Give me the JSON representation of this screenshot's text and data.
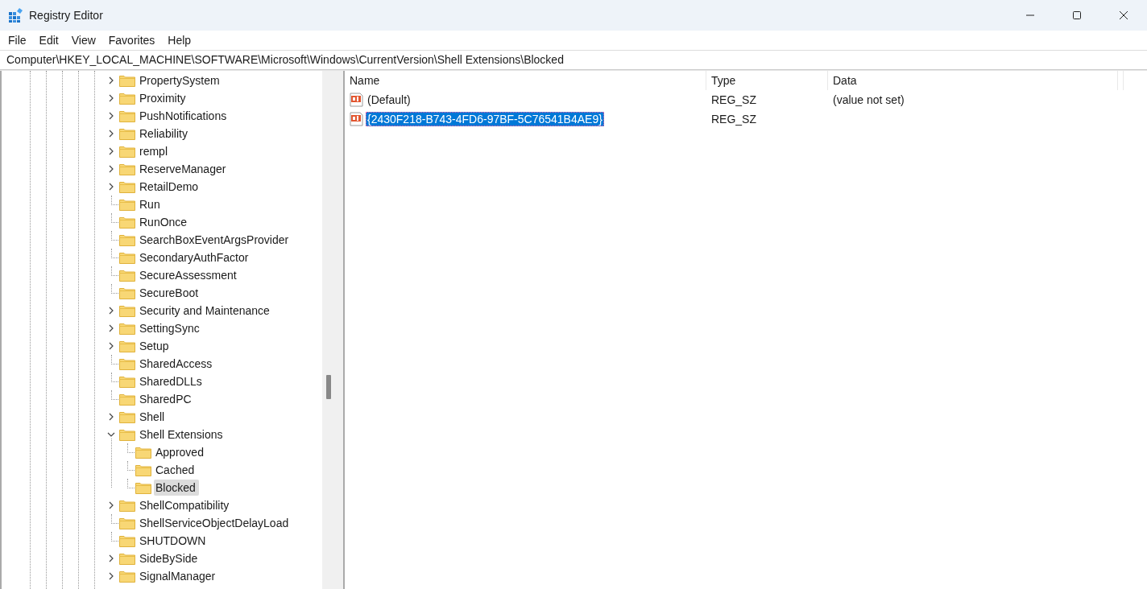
{
  "window": {
    "title": "Registry Editor"
  },
  "menu": [
    "File",
    "Edit",
    "View",
    "Favorites",
    "Help"
  ],
  "address": "Computer\\HKEY_LOCAL_MACHINE\\SOFTWARE\\Microsoft\\Windows\\CurrentVersion\\Shell Extensions\\Blocked",
  "tree": [
    {
      "name": "PropertySystem",
      "expandable": true,
      "expanded": false,
      "selected": false
    },
    {
      "name": "Proximity",
      "expandable": true,
      "expanded": false,
      "selected": false
    },
    {
      "name": "PushNotifications",
      "expandable": true,
      "expanded": false,
      "selected": false
    },
    {
      "name": "Reliability",
      "expandable": true,
      "expanded": false,
      "selected": false
    },
    {
      "name": "rempl",
      "expandable": true,
      "expanded": false,
      "selected": false
    },
    {
      "name": "ReserveManager",
      "expandable": true,
      "expanded": false,
      "selected": false
    },
    {
      "name": "RetailDemo",
      "expandable": true,
      "expanded": false,
      "selected": false
    },
    {
      "name": "Run",
      "expandable": false,
      "selected": false
    },
    {
      "name": "RunOnce",
      "expandable": false,
      "selected": false
    },
    {
      "name": "SearchBoxEventArgsProvider",
      "expandable": false,
      "selected": false
    },
    {
      "name": "SecondaryAuthFactor",
      "expandable": false,
      "selected": false
    },
    {
      "name": "SecureAssessment",
      "expandable": false,
      "selected": false
    },
    {
      "name": "SecureBoot",
      "expandable": false,
      "selected": false
    },
    {
      "name": "Security and Maintenance",
      "expandable": true,
      "expanded": false,
      "selected": false
    },
    {
      "name": "SettingSync",
      "expandable": true,
      "expanded": false,
      "selected": false
    },
    {
      "name": "Setup",
      "expandable": true,
      "expanded": false,
      "selected": false
    },
    {
      "name": "SharedAccess",
      "expandable": false,
      "selected": false
    },
    {
      "name": "SharedDLLs",
      "expandable": false,
      "selected": false
    },
    {
      "name": "SharedPC",
      "expandable": false,
      "selected": false
    },
    {
      "name": "Shell",
      "expandable": true,
      "expanded": false,
      "selected": false
    },
    {
      "name": "Shell Extensions",
      "expandable": true,
      "expanded": true,
      "selected": false,
      "children": [
        {
          "name": "Approved",
          "expandable": false,
          "selected": false
        },
        {
          "name": "Cached",
          "expandable": false,
          "selected": false
        },
        {
          "name": "Blocked",
          "expandable": false,
          "selected": true
        }
      ]
    },
    {
      "name": "ShellCompatibility",
      "expandable": true,
      "expanded": false,
      "selected": false
    },
    {
      "name": "ShellServiceObjectDelayLoad",
      "expandable": false,
      "selected": false
    },
    {
      "name": "SHUTDOWN",
      "expandable": false,
      "selected": false
    },
    {
      "name": "SideBySide",
      "expandable": true,
      "expanded": false,
      "selected": false
    },
    {
      "name": "SignalManager",
      "expandable": true,
      "expanded": false,
      "selected": false
    }
  ],
  "table": {
    "columns": [
      "Name",
      "Type",
      "Data"
    ],
    "rows": [
      {
        "name": "(Default)",
        "type": "REG_SZ",
        "data": "(value not set)",
        "selected": false
      },
      {
        "name": "{2430F218-B743-4FD6-97BF-5C76541B4AE9}",
        "type": "REG_SZ",
        "selected": true
      }
    ]
  }
}
